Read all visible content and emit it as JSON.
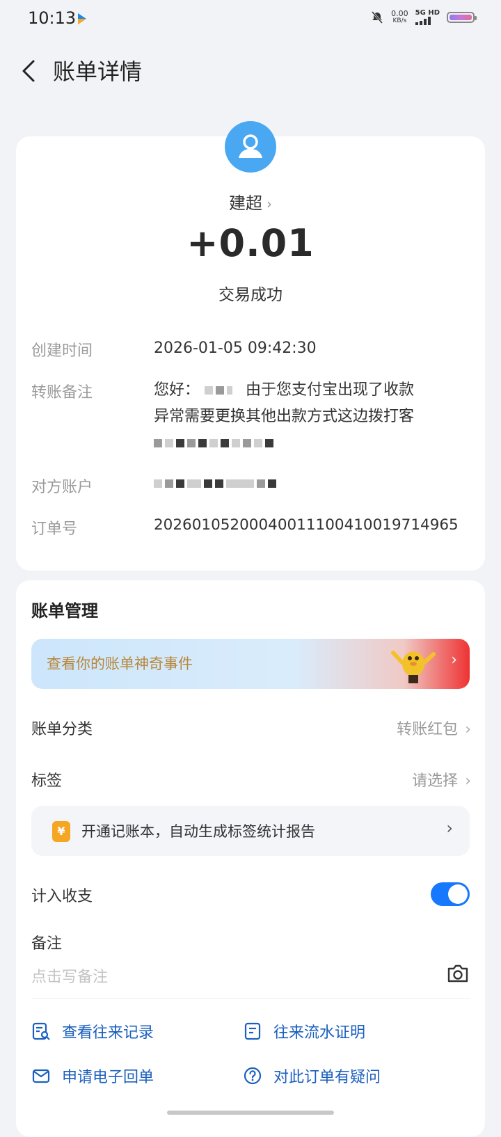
{
  "status": {
    "time": "10:13",
    "net_speed": "0.00",
    "net_unit": "KB/s",
    "signal_label": "5G HD"
  },
  "header": {
    "title": "账单详情"
  },
  "bill": {
    "payee": "建超",
    "amount": "+0.01",
    "result": "交易成功",
    "fields": {
      "created_label": "创建时间",
      "created_value": "2026-01-05 09:42:30",
      "memo_label": "转账备注",
      "memo_line1_a": "您好：",
      "memo_line1_b": "由于您支付宝出现了收款",
      "memo_line2": "异常需要更换其他出款方式这边拨打客",
      "account_label": "对方账户",
      "order_label": "订单号",
      "order_value": "20260105200040011100410019714965"
    }
  },
  "manage": {
    "title": "账单管理",
    "banner_text": "查看你的账单神奇事件",
    "category_label": "账单分类",
    "category_value": "转账红包",
    "tag_label": "标签",
    "tag_value": "请选择",
    "tip_icon": "¥",
    "tip_text": "开通记账本，自动生成标签统计报告",
    "income_label": "计入收支",
    "memo_label": "备注",
    "memo_placeholder": "点击写备注",
    "links": {
      "history": "查看往来记录",
      "statement": "往来流水证明",
      "receipt": "申请电子回单",
      "question": "对此订单有疑问"
    }
  },
  "colors": {
    "accent": "#1677ff",
    "link": "#1a5fbf",
    "avatar": "#4aa8f2"
  }
}
